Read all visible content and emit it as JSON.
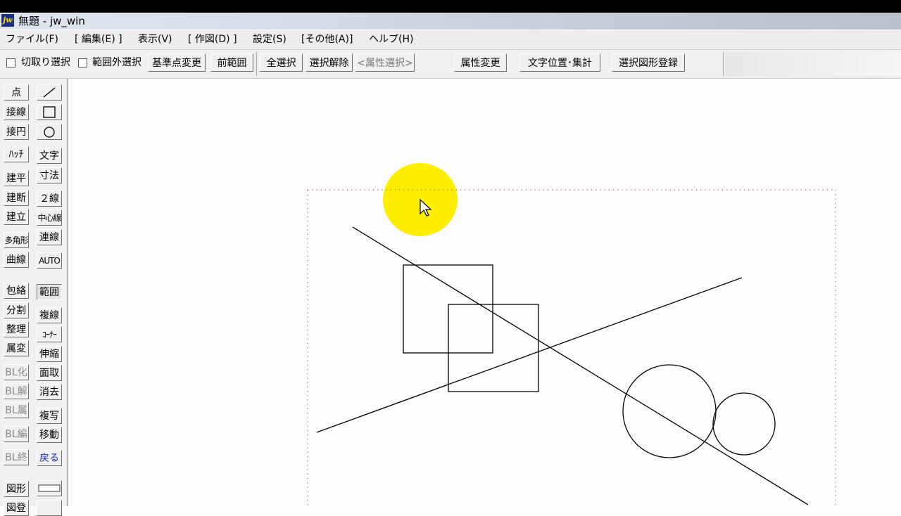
{
  "window": {
    "title": "無題 - jw_win",
    "app_icon": "jw"
  },
  "menu": [
    "ファイル(F)",
    "[ 編集(E) ]",
    "表示(V)",
    "[ 作図(D) ]",
    "設定(S)",
    "[その他(A)]",
    "ヘルプ(H)"
  ],
  "toolbar": {
    "checkbox1": "切取り選択",
    "checkbox2": "範囲外選択",
    "buttons": [
      "基準点変更",
      "前範囲",
      "全選択",
      "選択解除",
      "<属性選択>",
      "属性変更",
      "文字位置･集計",
      "選択図形登録"
    ]
  },
  "palette": {
    "left": [
      "点",
      "接線",
      "接円",
      "ﾊｯﾁ",
      "建平",
      "建断",
      "建立",
      "多角形",
      "曲線",
      "包絡",
      "分割",
      "整理",
      "属変",
      "BL化",
      "BL解",
      "BL属",
      "BL編",
      "BL終",
      "図形",
      "図登"
    ],
    "right_text": [
      "文字",
      "寸法",
      "２線",
      "中心線",
      "連線",
      "AUTO",
      "範囲",
      "複線",
      "ｺｰﾅｰ",
      "伸縮",
      "面取",
      "消去",
      "複写",
      "移動",
      "戻る"
    ],
    "right_icons": [
      "line-tool-icon",
      "rectangle-tool-icon",
      "circle-tool-icon"
    ]
  },
  "colors": {
    "title_bar": "#d4dde8",
    "menu_bar": "#ededed",
    "toolbar": "#f0f0f0",
    "canvas": "#fdfdfd",
    "cursor_highlight": "#ffee00",
    "back_button_text": "#1a2fb0",
    "selection_frame": "#c05050"
  }
}
